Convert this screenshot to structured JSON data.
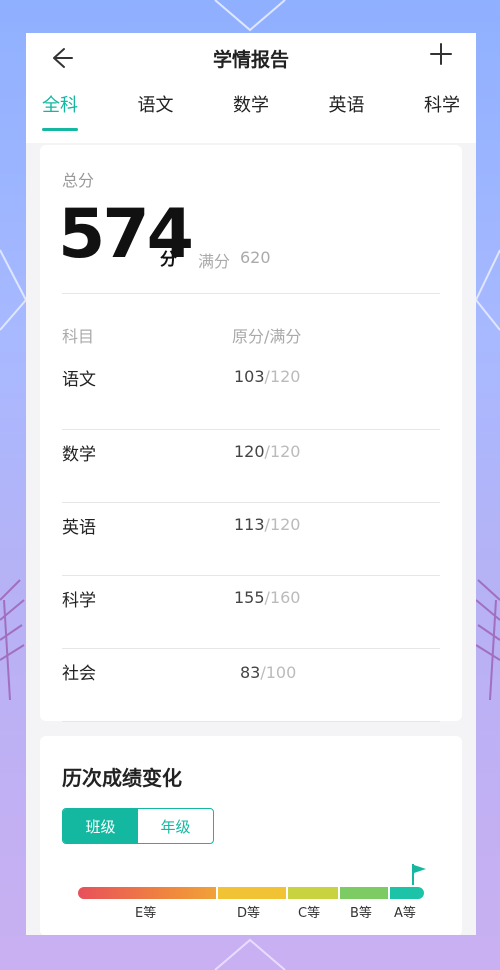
{
  "header": {
    "title": "学情报告"
  },
  "tabs": [
    {
      "label": "全科",
      "active": true
    },
    {
      "label": "语文",
      "active": false
    },
    {
      "label": "数学",
      "active": false
    },
    {
      "label": "英语",
      "active": false
    },
    {
      "label": "科学",
      "active": false
    }
  ],
  "summary": {
    "total_label": "总分",
    "total_score": "574",
    "unit": "分",
    "full_label": "满分",
    "full_score": "620"
  },
  "table": {
    "headers": {
      "subject": "科目",
      "score": "原分/满分"
    },
    "rows": [
      {
        "subject": "语文",
        "score": "103",
        "full": "/120"
      },
      {
        "subject": "数学",
        "score": "120",
        "full": "/120"
      },
      {
        "subject": "英语",
        "score": "113",
        "full": "/120"
      },
      {
        "subject": "科学",
        "score": "155",
        "full": "/160"
      },
      {
        "subject": "社会",
        "score": "83",
        "full": "/100"
      }
    ]
  },
  "history": {
    "title": "历次成绩变化",
    "toggle": [
      {
        "label": "班级",
        "active": true
      },
      {
        "label": "年级",
        "active": false
      }
    ],
    "grades": [
      "E等",
      "D等",
      "C等",
      "B等",
      "A等"
    ]
  },
  "colors": {
    "accent": "#14b8a0"
  },
  "icons": [
    "back-icon",
    "plus-icon",
    "flag-icon"
  ]
}
